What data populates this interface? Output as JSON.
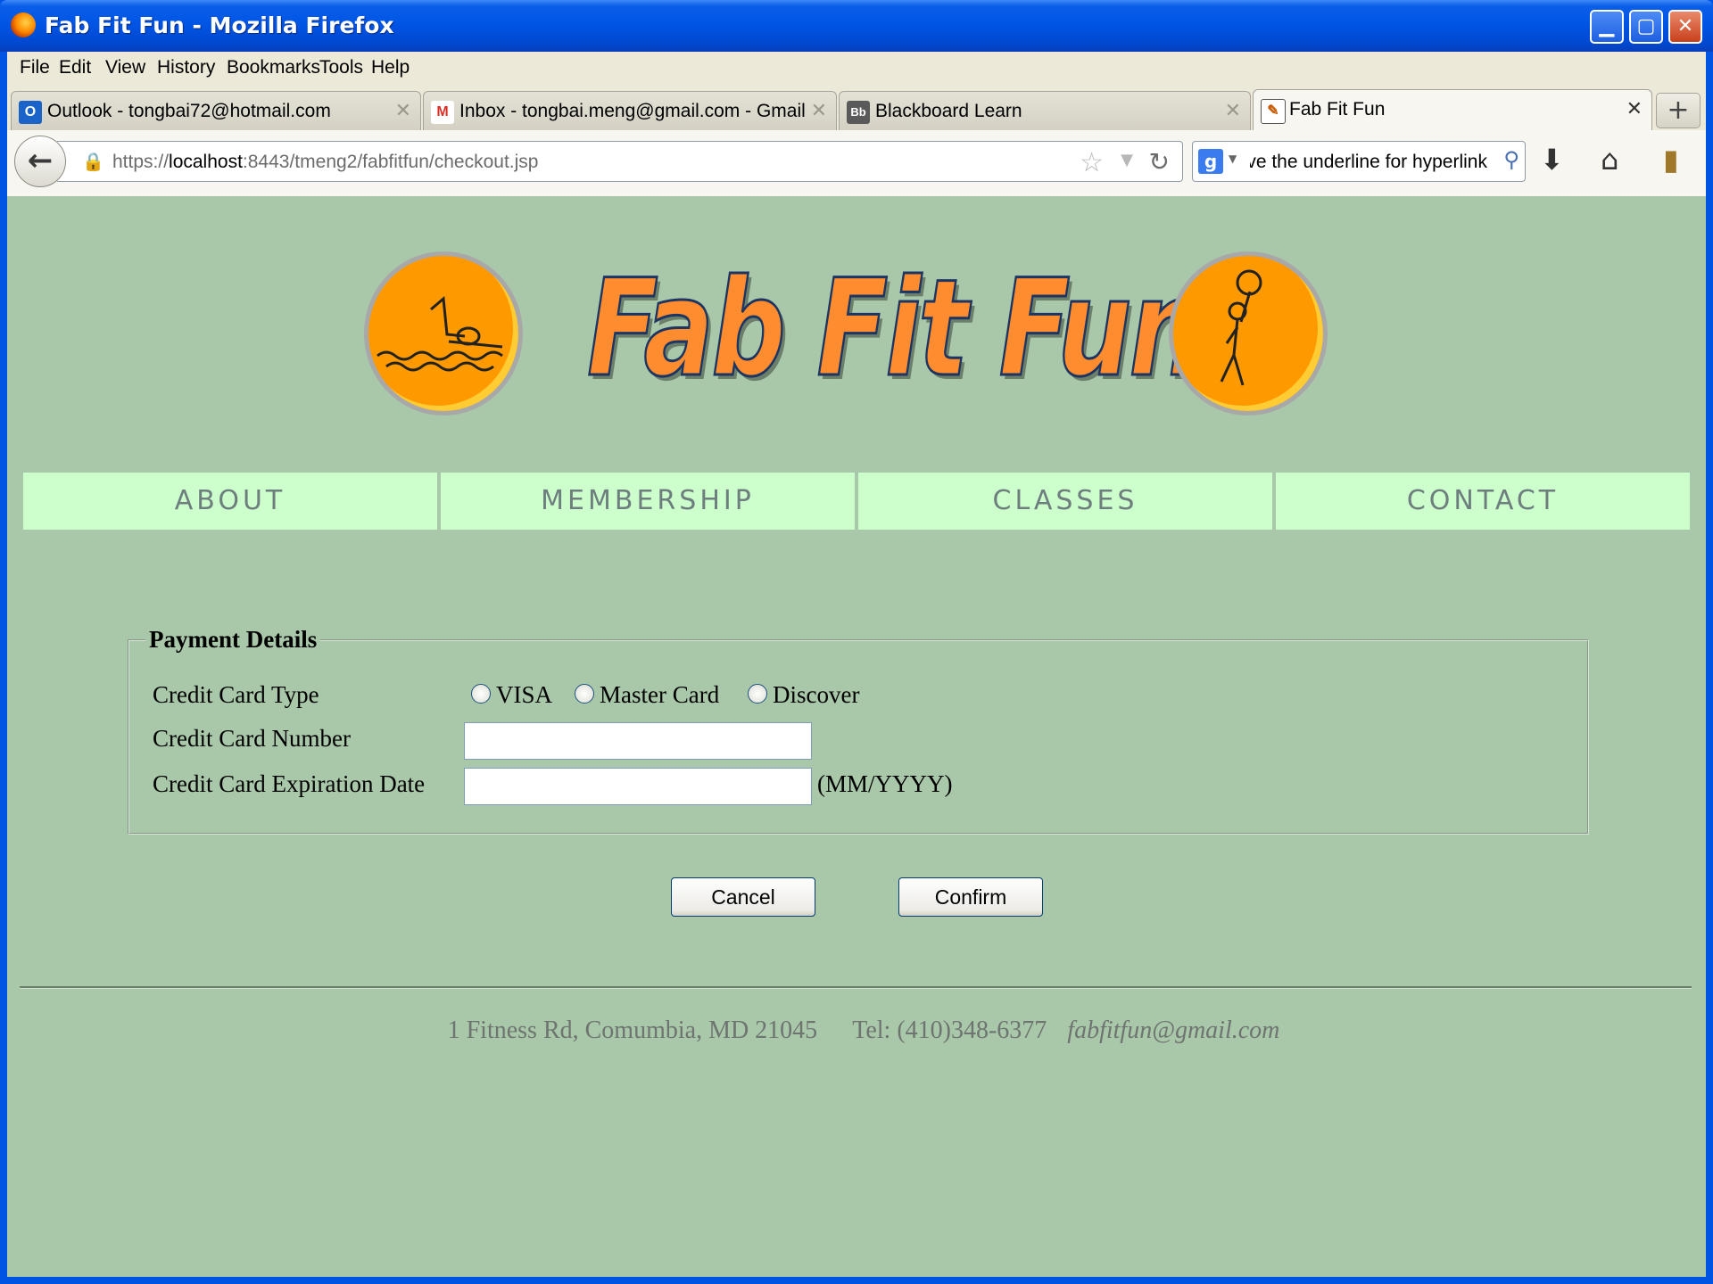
{
  "window": {
    "title": "Fab Fit Fun - Mozilla Firefox",
    "controls": {
      "minimize": "▁",
      "maximize": "▢",
      "close": "✕"
    }
  },
  "menu": [
    "File",
    "Edit",
    "View",
    "History",
    "Bookmarks",
    "Tools",
    "Help"
  ],
  "tabs": [
    {
      "icon": "outlook-icon",
      "icon_text": "O",
      "label": "Outlook - tongbai72@hotmail.com",
      "active": false
    },
    {
      "icon": "gmail-icon",
      "icon_text": "M",
      "label": "Inbox - tongbai.meng@gmail.com - Gmail",
      "active": false
    },
    {
      "icon": "blackboard-icon",
      "icon_text": "Bb",
      "label": "Blackboard Learn",
      "active": false
    },
    {
      "icon": "fabfitfun-favicon",
      "icon_text": "✎",
      "label": "Fab Fit Fun",
      "active": true
    }
  ],
  "tab_close_glyph": "✕",
  "new_tab_glyph": "+",
  "navbar": {
    "url_prefix": "https://",
    "url_host": "localhost",
    "url_path": ":8443/tmeng2/fabfitfun/checkout.jsp",
    "search_query": "ve the underline for hyperlink",
    "search_engine_letter": "g"
  },
  "site": {
    "logo_text": "Fab Fit Fun",
    "nav": [
      "ABOUT",
      "MEMBERSHIP",
      "CLASSES",
      "CONTACT"
    ]
  },
  "form": {
    "legend": "Payment Details",
    "card_type_label": "Credit Card Type",
    "card_types": [
      "VISA",
      "Master Card",
      "Discover"
    ],
    "card_number_label": "Credit Card Number",
    "card_number_value": "",
    "expiration_label": "Credit Card Expiration Date",
    "expiration_value": "",
    "expiration_hint": "(MM/YYYY)",
    "cancel_label": "Cancel",
    "confirm_label": "Confirm"
  },
  "footer": {
    "address": "1 Fitness Rd, Comumbia, MD  21045",
    "tel": "Tel: (410)348-6377",
    "email": "fabfitfun@gmail.com"
  },
  "colors": {
    "page_bg": "#a9c7a9",
    "nav_bg": "#ccffcc",
    "logo_orange": "#ff9900"
  }
}
